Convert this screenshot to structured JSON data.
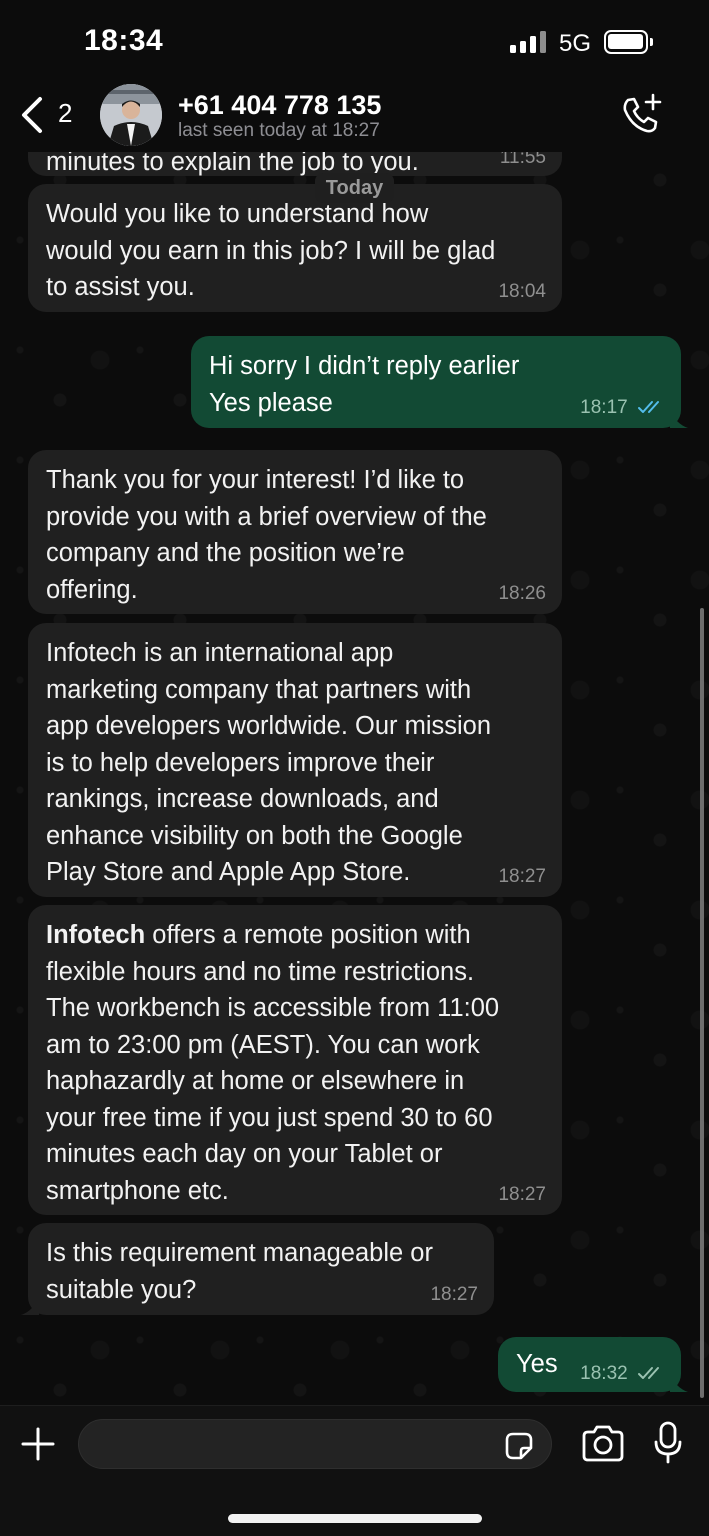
{
  "status_bar": {
    "time": "18:34",
    "network": "5G"
  },
  "header": {
    "back_count": "2",
    "contact_name": "+61 404 778 135",
    "last_seen": "last seen today at 18:27"
  },
  "date_divider": "Today",
  "messages": [
    {
      "direction": "incoming",
      "text": "minutes to explain the job to you.",
      "time": "11:55"
    },
    {
      "direction": "incoming",
      "text": "Would you like to understand how\nwould you earn in this job? I will be glad\nto assist you.",
      "time": "18:04"
    },
    {
      "direction": "outgoing",
      "text": "Hi sorry I didn’t reply earlier\nYes please",
      "time": "18:17",
      "status": "read"
    },
    {
      "direction": "incoming",
      "text": "Thank you for your interest! I’d like to\nprovide you with a brief overview of the\ncompany and the position we’re\noffering.",
      "time": "18:26"
    },
    {
      "direction": "incoming",
      "text": "Infotech is an international app\nmarketing company that partners with\napp developers worldwide. Our mission\nis to help developers improve their\nrankings, increase downloads, and\nenhance visibility on both the Google\nPlay Store and Apple App Store.",
      "time": "18:27"
    },
    {
      "direction": "incoming",
      "bold": "Infotech",
      "text": " offers a remote position with\nflexible hours and no time restrictions.\nThe workbench is accessible from 11:00\nam to 23:00 pm (AEST). You can work\nhaphazardly at home or elsewhere in\nyour free time if you just spend 30 to 60\nminutes each day on your Tablet or\nsmartphone etc.",
      "time": "18:27"
    },
    {
      "direction": "incoming",
      "text": "Is this requirement manageable or\nsuitable you?",
      "time": "18:27"
    },
    {
      "direction": "outgoing",
      "text": "Yes",
      "time": "18:32",
      "status": "delivered"
    }
  ],
  "composer": {
    "value": "",
    "placeholder": ""
  },
  "colors": {
    "incoming_bubble": "#202020",
    "outgoing_bubble": "#124a34",
    "read_tick": "#53bdeb",
    "background": "#0c0c0c"
  },
  "icons": [
    "back-chevron-icon",
    "call-add-icon",
    "plus-icon",
    "sticker-icon",
    "camera-icon",
    "microphone-icon"
  ]
}
